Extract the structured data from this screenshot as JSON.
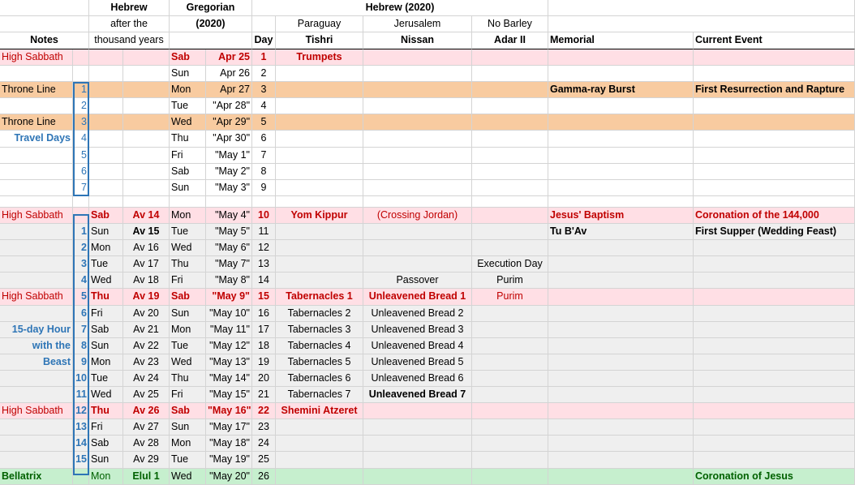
{
  "header": {
    "row1": {
      "hebrew": "Hebrew",
      "gregorian": "Gregorian",
      "hebrew2020": "Hebrew (2020)"
    },
    "row2": {
      "after": "after the",
      "year": "(2020)",
      "paraguay": "Paraguay",
      "jerusalem": "Jerusalem",
      "nobarley": "No Barley"
    },
    "row3": {
      "notes": "Notes",
      "thousand": "thousand years",
      "day": "Day",
      "tishri": "Tishri",
      "nissan": "Nissan",
      "adar": "Adar II",
      "memorial": "Memorial",
      "current": "Current Event"
    }
  },
  "rows": [
    {
      "type": "hs",
      "notes": "High Sabbath",
      "n": "",
      "wd": "",
      "av": "",
      "gwd": "Sab",
      "gdate": "Apr 25",
      "day": "1",
      "tishri": "Trumpets",
      "nissan": "",
      "adar": "",
      "memorial": "",
      "current": ""
    },
    {
      "type": "w",
      "notes": "",
      "n": "",
      "wd": "",
      "av": "",
      "gwd": "Sun",
      "gdate": "Apr 26",
      "day": "2",
      "tishri": "",
      "nissan": "",
      "adar": "",
      "memorial": "",
      "current": ""
    },
    {
      "type": "or",
      "notes": "Throne Line",
      "n": "1",
      "wd": "",
      "av": "",
      "gwd": "Mon",
      "gdate": "Apr 27",
      "day": "3",
      "tishri": "",
      "nissan": "",
      "adar": "",
      "memorial": "Gamma-ray Burst",
      "current": "First Resurrection and Rapture"
    },
    {
      "type": "w",
      "notes": "",
      "n": "2",
      "wd": "",
      "av": "",
      "gwd": "Tue",
      "gdate": "\"Apr 28\"",
      "day": "4",
      "tishri": "",
      "nissan": "",
      "adar": "",
      "memorial": "",
      "current": ""
    },
    {
      "type": "or",
      "notes": "Throne Line",
      "n": "3",
      "wd": "",
      "av": "",
      "gwd": "Wed",
      "gdate": "\"Apr 29\"",
      "day": "5",
      "tishri": "",
      "nissan": "",
      "adar": "",
      "memorial": "",
      "current": ""
    },
    {
      "type": "w",
      "notes": "Travel Days",
      "n": "4",
      "wd": "",
      "av": "",
      "gwd": "Thu",
      "gdate": "\"Apr 30\"",
      "day": "6",
      "tishri": "",
      "nissan": "",
      "adar": "",
      "memorial": "",
      "current": ""
    },
    {
      "type": "w",
      "notes": "",
      "n": "5",
      "wd": "",
      "av": "",
      "gwd": "Fri",
      "gdate": "\"May 1\"",
      "day": "7",
      "tishri": "",
      "nissan": "",
      "adar": "",
      "memorial": "",
      "current": ""
    },
    {
      "type": "w",
      "notes": "",
      "n": "6",
      "wd": "",
      "av": "",
      "gwd": "Sab",
      "gdate": "\"May 2\"",
      "day": "8",
      "tishri": "",
      "nissan": "",
      "adar": "",
      "memorial": "",
      "current": ""
    },
    {
      "type": "w",
      "notes": "",
      "n": "7",
      "wd": "",
      "av": "",
      "gwd": "Sun",
      "gdate": "\"May 3\"",
      "day": "9",
      "tishri": "",
      "nissan": "",
      "adar": "",
      "memorial": "",
      "current": ""
    },
    {
      "type": "gap"
    },
    {
      "type": "hs",
      "notes": "High Sabbath",
      "n": "",
      "wd": "Sab",
      "av": "Av 14",
      "gwd": "Mon",
      "gdate": "\"May 4\"",
      "day": "10",
      "tishri": "Yom Kippur",
      "nissan": "(Crossing Jordan)",
      "adar": "",
      "memorial": "Jesus' Baptism",
      "current": "Coronation of the 144,000"
    },
    {
      "type": "g",
      "notes": "",
      "n": "1",
      "wd": "Sun",
      "av": "Av 15",
      "gwd": "Tue",
      "gdate": "\"May 5\"",
      "day": "11",
      "tishri": "",
      "nissan": "",
      "adar": "",
      "memorial": "Tu B'Av",
      "current": "First Supper (Wedding Feast)"
    },
    {
      "type": "g",
      "notes": "",
      "n": "2",
      "wd": "Mon",
      "av": "Av 16",
      "gwd": "Wed",
      "gdate": "\"May 6\"",
      "day": "12",
      "tishri": "",
      "nissan": "",
      "adar": "",
      "memorial": "",
      "current": ""
    },
    {
      "type": "g",
      "notes": "",
      "n": "3",
      "wd": "Tue",
      "av": "Av 17",
      "gwd": "Thu",
      "gdate": "\"May 7\"",
      "day": "13",
      "tishri": "",
      "nissan": "",
      "adar": "Execution Day",
      "memorial": "",
      "current": ""
    },
    {
      "type": "g",
      "notes": "",
      "n": "4",
      "wd": "Wed",
      "av": "Av 18",
      "gwd": "Fri",
      "gdate": "\"May 8\"",
      "day": "14",
      "tishri": "",
      "nissan": "Passover",
      "adar": "Purim",
      "memorial": "",
      "current": ""
    },
    {
      "type": "hs",
      "notes": "High Sabbath",
      "n": "5",
      "wd": "Thu",
      "av": "Av 19",
      "gwd": "Sab",
      "gdate": "\"May 9\"",
      "day": "15",
      "tishri": "Tabernacles 1",
      "nissan": "Unleavened Bread 1",
      "adar": "Purim",
      "memorial": "",
      "current": ""
    },
    {
      "type": "g",
      "notes": "",
      "n": "6",
      "wd": "Fri",
      "av": "Av 20",
      "gwd": "Sun",
      "gdate": "\"May 10\"",
      "day": "16",
      "tishri": "Tabernacles 2",
      "nissan": "Unleavened Bread 2",
      "adar": "",
      "memorial": "",
      "current": ""
    },
    {
      "type": "g",
      "notes": "15-day Hour",
      "n": "7",
      "wd": "Sab",
      "av": "Av 21",
      "gwd": "Mon",
      "gdate": "\"May 11\"",
      "day": "17",
      "tishri": "Tabernacles 3",
      "nissan": "Unleavened Bread 3",
      "adar": "",
      "memorial": "",
      "current": ""
    },
    {
      "type": "g",
      "notes": "with the",
      "n": "8",
      "wd": "Sun",
      "av": "Av 22",
      "gwd": "Tue",
      "gdate": "\"May 12\"",
      "day": "18",
      "tishri": "Tabernacles 4",
      "nissan": "Unleavened Bread 4",
      "adar": "",
      "memorial": "",
      "current": ""
    },
    {
      "type": "g",
      "notes": "Beast",
      "n": "9",
      "wd": "Mon",
      "av": "Av 23",
      "gwd": "Wed",
      "gdate": "\"May 13\"",
      "day": "19",
      "tishri": "Tabernacles 5",
      "nissan": "Unleavened Bread 5",
      "adar": "",
      "memorial": "",
      "current": ""
    },
    {
      "type": "g",
      "notes": "",
      "n": "10",
      "wd": "Tue",
      "av": "Av 24",
      "gwd": "Thu",
      "gdate": "\"May 14\"",
      "day": "20",
      "tishri": "Tabernacles 6",
      "nissan": "Unleavened Bread 6",
      "adar": "",
      "memorial": "",
      "current": ""
    },
    {
      "type": "g",
      "notes": "",
      "n": "11",
      "wd": "Wed",
      "av": "Av 25",
      "gwd": "Fri",
      "gdate": "\"May 15\"",
      "day": "21",
      "tishri": "Tabernacles 7",
      "nissan": "Unleavened Bread 7",
      "adar": "",
      "memorial": "",
      "current": ""
    },
    {
      "type": "hs",
      "notes": "High Sabbath",
      "n": "12",
      "wd": "Thu",
      "av": "Av 26",
      "gwd": "Sab",
      "gdate": "\"May 16\"",
      "day": "22",
      "tishri": "Shemini Atzeret",
      "nissan": "",
      "adar": "",
      "memorial": "",
      "current": ""
    },
    {
      "type": "g",
      "notes": "",
      "n": "13",
      "wd": "Fri",
      "av": "Av 27",
      "gwd": "Sun",
      "gdate": "\"May 17\"",
      "day": "23",
      "tishri": "",
      "nissan": "",
      "adar": "",
      "memorial": "",
      "current": ""
    },
    {
      "type": "g",
      "notes": "",
      "n": "14",
      "wd": "Sab",
      "av": "Av 28",
      "gwd": "Mon",
      "gdate": "\"May 18\"",
      "day": "24",
      "tishri": "",
      "nissan": "",
      "adar": "",
      "memorial": "",
      "current": ""
    },
    {
      "type": "g",
      "notes": "",
      "n": "15",
      "wd": "Sun",
      "av": "Av 29",
      "gwd": "Tue",
      "gdate": "\"May 19\"",
      "day": "25",
      "tishri": "",
      "nissan": "",
      "adar": "",
      "memorial": "",
      "current": ""
    },
    {
      "type": "gr",
      "notes": "Bellatrix",
      "n": "",
      "wd": "Mon",
      "av": "Elul 1",
      "gwd": "Wed",
      "gdate": "\"May 20\"",
      "day": "26",
      "tishri": "",
      "nissan": "",
      "adar": "",
      "memorial": "",
      "current": "Coronation of Jesus"
    }
  ],
  "colors": {
    "high_sabbath": "#ffdfe5",
    "orange": "#f8cba0",
    "gray": "#efefef",
    "green": "#c6efce",
    "red": "#c00000",
    "blue": "#2e75b6"
  }
}
